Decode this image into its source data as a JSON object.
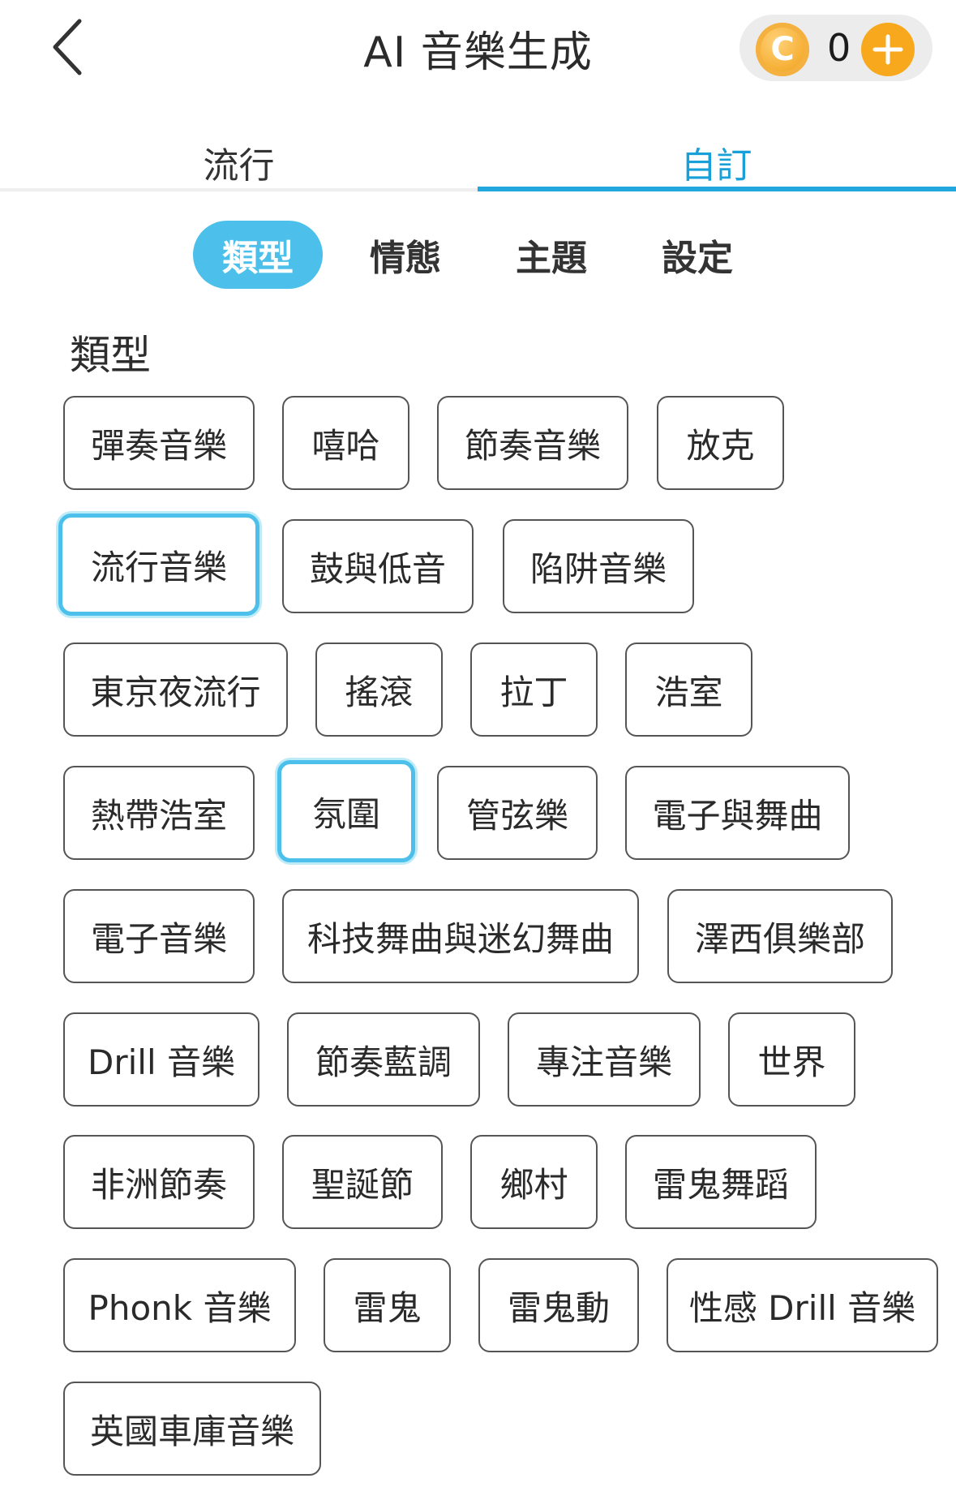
{
  "header": {
    "title": "AI 音樂生成",
    "coin_symbol": "C",
    "coin_count": "0",
    "accent_color": "#22a7df",
    "coin_color": "#f7b23a"
  },
  "main_tabs": [
    {
      "label": "流行",
      "active": false
    },
    {
      "label": "自訂",
      "active": true
    }
  ],
  "sub_tabs": [
    {
      "label": "類型",
      "active": true
    },
    {
      "label": "情態",
      "active": false
    },
    {
      "label": "主題",
      "active": false
    },
    {
      "label": "設定",
      "active": false
    }
  ],
  "section": {
    "title": "類型"
  },
  "genres": [
    {
      "label": "彈奏音樂",
      "selected": false
    },
    {
      "label": "嘻哈",
      "selected": false
    },
    {
      "label": "節奏音樂",
      "selected": false
    },
    {
      "label": "放克",
      "selected": false
    },
    {
      "label": "流行音樂",
      "selected": true
    },
    {
      "label": "鼓與低音",
      "selected": false
    },
    {
      "label": "陷阱音樂",
      "selected": false
    },
    {
      "label": "東京夜流行",
      "selected": false
    },
    {
      "label": "搖滾",
      "selected": false
    },
    {
      "label": "拉丁",
      "selected": false
    },
    {
      "label": "浩室",
      "selected": false
    },
    {
      "label": "熱帶浩室",
      "selected": false
    },
    {
      "label": "氛圍",
      "selected": true
    },
    {
      "label": "管弦樂",
      "selected": false
    },
    {
      "label": "電子與舞曲",
      "selected": false
    },
    {
      "label": "電子音樂",
      "selected": false
    },
    {
      "label": "科技舞曲與迷幻舞曲",
      "selected": false
    },
    {
      "label": "澤西俱樂部",
      "selected": false
    },
    {
      "label": "Drill 音樂",
      "selected": false
    },
    {
      "label": "節奏藍調",
      "selected": false
    },
    {
      "label": "專注音樂",
      "selected": false
    },
    {
      "label": "世界",
      "selected": false
    },
    {
      "label": "非洲節奏",
      "selected": false
    },
    {
      "label": "聖誕節",
      "selected": false
    },
    {
      "label": "鄉村",
      "selected": false
    },
    {
      "label": "雷鬼舞蹈",
      "selected": false
    },
    {
      "label": "Phonk 音樂",
      "selected": false
    },
    {
      "label": "雷鬼",
      "selected": false
    },
    {
      "label": "雷鬼動",
      "selected": false
    },
    {
      "label": "性感 Drill 音樂",
      "selected": false
    },
    {
      "label": "英國車庫音樂",
      "selected": false
    }
  ]
}
